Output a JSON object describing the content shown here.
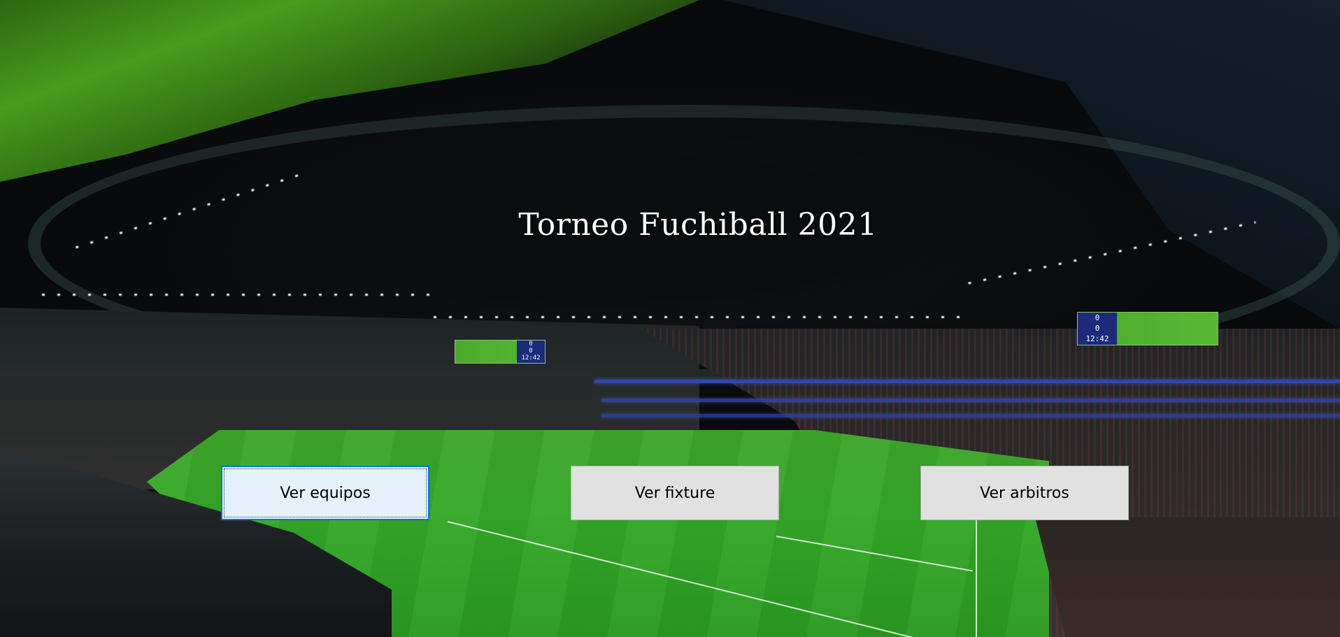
{
  "window": {
    "title": "Torneo Fuchiball 2021"
  },
  "background": {
    "scene": "stadium-photo",
    "scoreboard_left": {
      "line1": "0",
      "line2": "0",
      "clock": "12:42"
    },
    "scoreboard_right": {
      "line1": "0",
      "line2": "0",
      "clock": "12:42"
    }
  },
  "buttons": [
    {
      "label": "Ver equipos",
      "focused": true
    },
    {
      "label": "Ver fixture",
      "focused": false
    },
    {
      "label": "Ver arbitros",
      "focused": false
    }
  ]
}
